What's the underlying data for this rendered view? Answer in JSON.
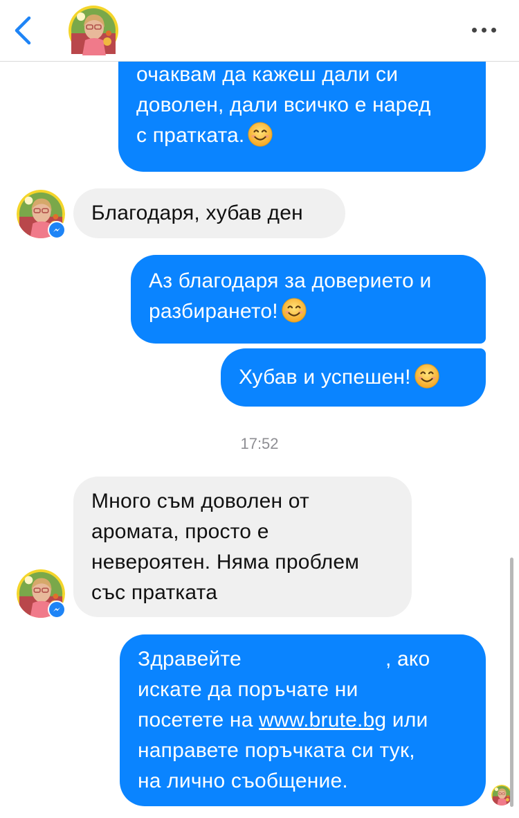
{
  "header": {
    "back_label": "Back",
    "more_label": "More options"
  },
  "messages": [
    {
      "lines": [
        "очаквам да кажеш дали си",
        "доволен, дали всичко е наред",
        "с пратката."
      ]
    },
    {
      "lines": [
        "Благодаря, хубав ден"
      ]
    },
    {
      "lines": [
        "Аз благодаря за доверието и",
        "разбирането!"
      ]
    },
    {
      "lines": [
        "Хубав и успешен!"
      ]
    },
    {
      "lines": [
        "Много съм доволен от",
        "аромата, просто е",
        "невероятен. Няма проблем",
        "със пратката"
      ]
    },
    {
      "line1_start": "Здравейте",
      "line1_end": ", ако",
      "line2": "искате да поръчате ни",
      "line3_start": "посетете на",
      "link": "www.brute.bg",
      "line3_end": "или",
      "line4": "направете поръчката си тук,",
      "line5": "на лично съобщение."
    }
  ],
  "timestamp": "17:52",
  "colors": {
    "outgoing_bubble": "#0a84ff",
    "incoming_bubble": "#f0f0f0",
    "accent": "#1e84f6",
    "timestamp": "#8e8e93"
  },
  "icons": {
    "back": "chevron-left-icon",
    "more": "more-horizontal-icon",
    "emoji": "smiling-face-icon",
    "messenger": "messenger-badge-icon"
  }
}
